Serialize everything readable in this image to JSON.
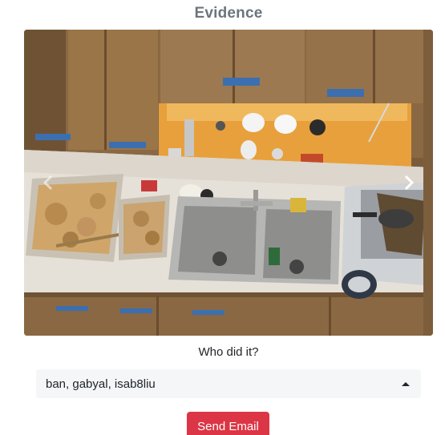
{
  "page": {
    "title": "Evidence"
  },
  "carousel": {
    "prev_icon": "chevron-left-icon",
    "next_icon": "chevron-right-icon"
  },
  "form": {
    "question": "Who did it?",
    "selected_value": "ban, gabyal, isab8liu",
    "send_label": "Send Email"
  },
  "colors": {
    "title": "#6c757d",
    "send_button": "#dc3545",
    "select_background": "#f4f6f8"
  }
}
